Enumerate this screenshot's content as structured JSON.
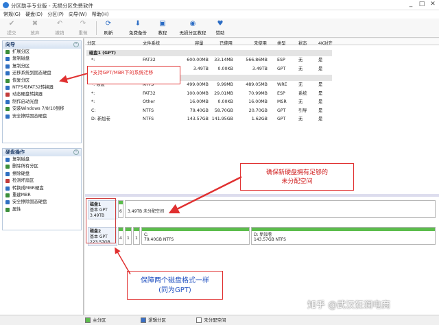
{
  "window": {
    "title": "分区助手专业版 - 无损分区免费软件",
    "controls": [
      "_",
      "□",
      "✕"
    ]
  },
  "menu": [
    "常规(G)",
    "硬盘(D)",
    "分区(P)",
    "向导(W)",
    "帮助(H)"
  ],
  "toolbar": [
    {
      "label": "提交",
      "icon": "✔",
      "enabled": false
    },
    {
      "label": "放弃",
      "icon": "✖",
      "enabled": false
    },
    {
      "label": "撤销",
      "icon": "↶",
      "enabled": false
    },
    {
      "label": "重做",
      "icon": "↷",
      "enabled": false
    },
    {
      "label": "刷新",
      "icon": "⟳",
      "enabled": true
    },
    {
      "label": "免费备份",
      "icon": "⬇",
      "enabled": true
    },
    {
      "label": "教程",
      "icon": "▣",
      "enabled": true
    },
    {
      "label": "无损分区教程",
      "icon": "◉",
      "enabled": true
    },
    {
      "label": "赞助",
      "icon": "♥",
      "enabled": true
    }
  ],
  "wizard": {
    "title": "向导",
    "items": [
      "扩展分区",
      "复制磁盘",
      "复制分区",
      "迁移系统到固态硬盘",
      "恢复分区",
      "NTFS与FAT32转换器",
      "动态硬盘转换器",
      "制作启动光盘",
      "安装Windows 7/8/10到移",
      "安全擦除固态硬盘"
    ]
  },
  "disk_ops": {
    "title": "硬盘操作",
    "items": [
      "复制磁盘",
      "删除所有分区",
      "擦除硬盘",
      "检测坏扇区",
      "转换成MBR硬盘",
      "重建MBR",
      "安全擦除固态硬盘",
      "属性"
    ]
  },
  "table": {
    "headers": [
      "分区",
      "文件系统",
      "容量",
      "已使用",
      "未使用",
      "类型",
      "状态",
      "4K对齐"
    ],
    "disks": [
      {
        "label": "磁盘1 (GPT)",
        "rows": [
          [
            "*:",
            "FAT32",
            "600.00MB",
            "33.14MB",
            "566.86MB",
            "ESP",
            "无",
            "是"
          ],
          [
            "*:",
            "未分配空间",
            "3.49TB",
            "0.00KB",
            "3.49TB",
            "GPT",
            "无",
            "是"
          ]
        ]
      },
      {
        "label": "磁盘2 (GPT)",
        "rows": [
          [
            "*: 恢复",
            "NTFS",
            "499.00MB",
            "9.99MB",
            "489.05MB",
            "WRE",
            "无",
            "是"
          ],
          [
            "*:",
            "FAT32",
            "100.00MB",
            "29.01MB",
            "70.99MB",
            "ESP",
            "系统",
            "是"
          ],
          [
            "*:",
            "Other",
            "16.00MB",
            "0.00KB",
            "16.00MB",
            "MSR",
            "无",
            "是"
          ],
          [
            "C:",
            "NTFS",
            "79.40GB",
            "58.70GB",
            "20.70GB",
            "GPT",
            "引导",
            "是"
          ],
          [
            "D: 新加卷",
            "NTFS",
            "143.57GB",
            "141.95GB",
            "1.62GB",
            "GPT",
            "无",
            "是"
          ]
        ]
      }
    ]
  },
  "disk_map": {
    "disk1": {
      "name": "磁盘1",
      "type": "基本 GPT",
      "size": "3.49TB",
      "small": "6",
      "unalloc": "3.49TB 未分配空间"
    },
    "disk2": {
      "name": "磁盘2",
      "type": "基本 GPT",
      "size": "223.57GB",
      "small": [
        "4",
        "1",
        "1"
      ],
      "c_name": "C:",
      "c_info": "79.40GB NTFS",
      "d_name": "D: 新加卷",
      "d_info": "143.57GB NTFS"
    }
  },
  "annotations": {
    "a1": "*支持GPT/MBR下的系统迁移",
    "a2_line1": "确保新硬盘拥有足够的",
    "a2_line2": "未分配空间",
    "a3_line1": "保障两个磁盘格式一样",
    "a3_line2": "(同为GPT)"
  },
  "legend": [
    "主分区",
    "逻辑分区",
    "未分配空间"
  ],
  "colors": {
    "primary": "#5cbd4c",
    "logical": "#3a6fc4",
    "unalloc": "#ffffff",
    "annotation": "#e03030"
  },
  "watermark": "知乎 @武汉狂澜电商"
}
